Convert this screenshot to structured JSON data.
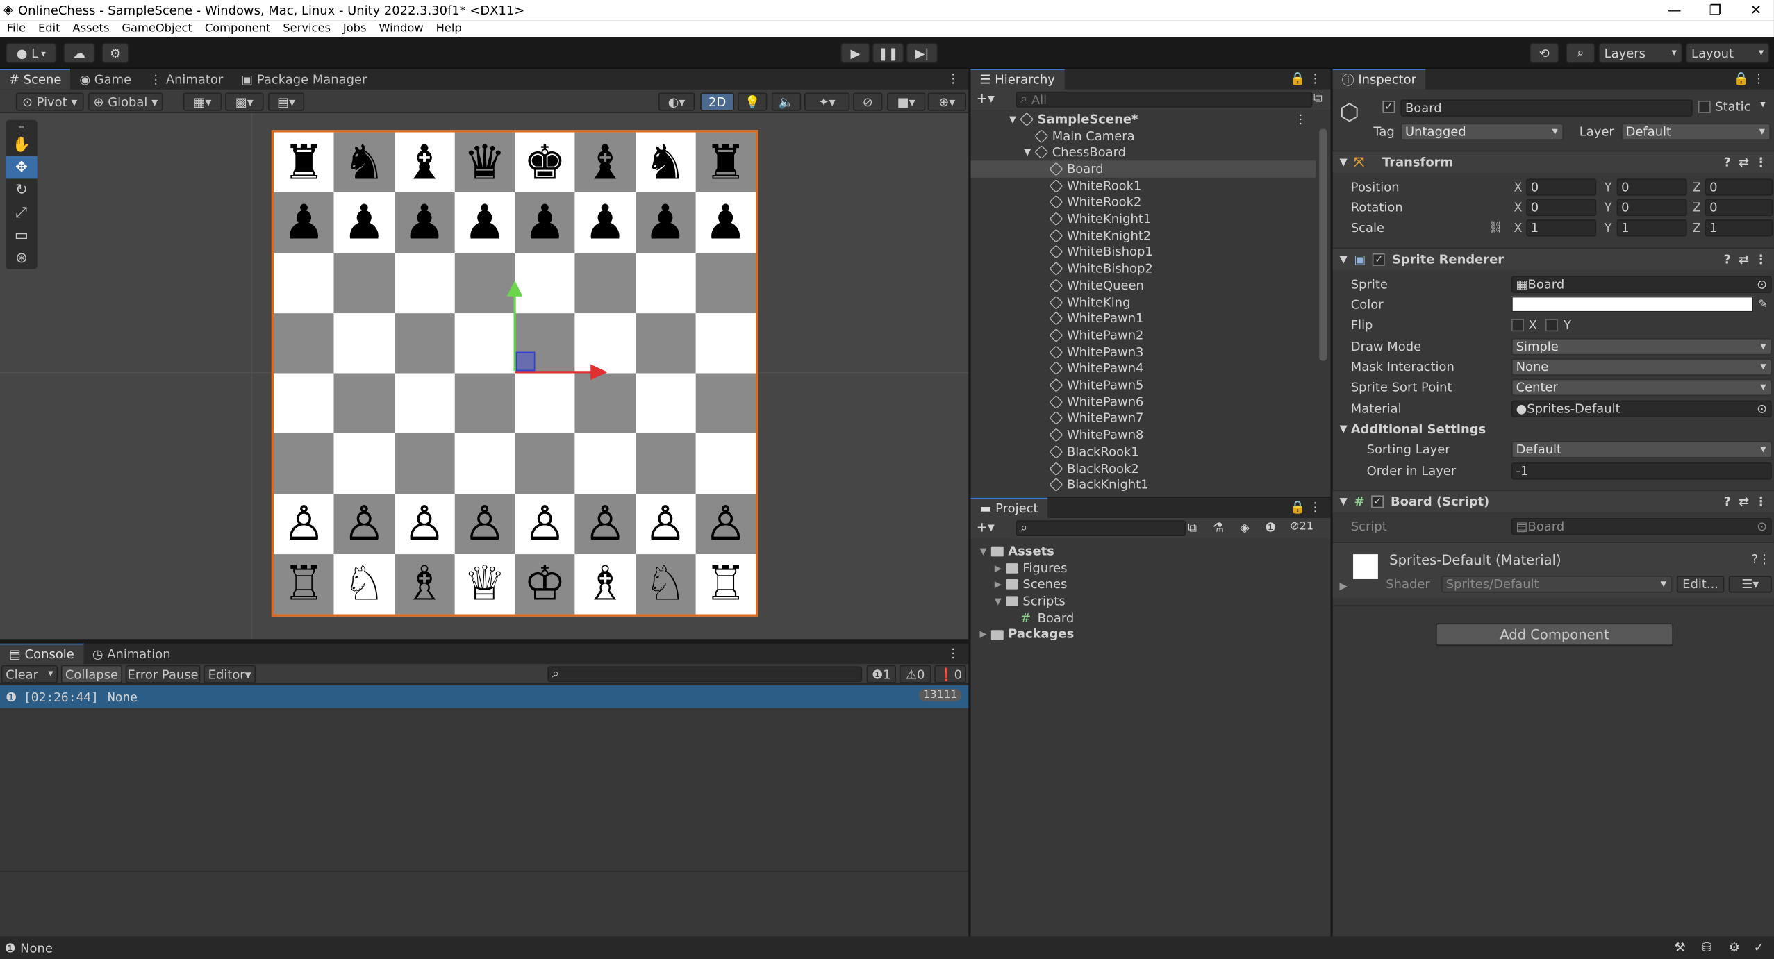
{
  "window": {
    "title": "OnlineChess - SampleScene - Windows, Mac, Linux - Unity 2022.3.30f1* <DX11>"
  },
  "menu": [
    "File",
    "Edit",
    "Assets",
    "GameObject",
    "Component",
    "Services",
    "Jobs",
    "Window",
    "Help"
  ],
  "toolbar": {
    "account_label": "L",
    "layers_label": "Layers",
    "layout_label": "Layout"
  },
  "scene_tabs": [
    "Scene",
    "Game",
    "Animator",
    "Package Manager"
  ],
  "scene_bar": {
    "pivot": "Pivot",
    "global": "Global",
    "mode_2d": "2D"
  },
  "board": {
    "rows": [
      [
        "♜",
        "♞",
        "♝",
        "♛",
        "♚",
        "♝",
        "♞",
        "♜"
      ],
      [
        "♟",
        "♟",
        "♟",
        "♟",
        "♟",
        "♟",
        "♟",
        "♟"
      ],
      [
        "",
        "",
        "",
        "",
        "",
        "",
        "",
        ""
      ],
      [
        "",
        "",
        "",
        "",
        "",
        "",
        "",
        ""
      ],
      [
        "",
        "",
        "",
        "",
        "",
        "",
        "",
        ""
      ],
      [
        "",
        "",
        "",
        "",
        "",
        "",
        "",
        ""
      ],
      [
        "♙",
        "♙",
        "♙",
        "♙",
        "♙",
        "♙",
        "♙",
        "♙"
      ],
      [
        "♖",
        "♘",
        "♗",
        "♕",
        "♔",
        "♗",
        "♘",
        "♖"
      ]
    ]
  },
  "hierarchy": {
    "title": "Hierarchy",
    "search_placeholder": "All",
    "items": [
      {
        "label": "SampleScene*",
        "depth": 0
      },
      {
        "label": "Main Camera",
        "depth": 1
      },
      {
        "label": "ChessBoard",
        "depth": 1
      },
      {
        "label": "Board",
        "depth": 2,
        "selected": true
      },
      {
        "label": "WhiteRook1",
        "depth": 2
      },
      {
        "label": "WhiteRook2",
        "depth": 2
      },
      {
        "label": "WhiteKnight1",
        "depth": 2
      },
      {
        "label": "WhiteKnight2",
        "depth": 2
      },
      {
        "label": "WhiteBishop1",
        "depth": 2
      },
      {
        "label": "WhiteBishop2",
        "depth": 2
      },
      {
        "label": "WhiteQueen",
        "depth": 2
      },
      {
        "label": "WhiteKing",
        "depth": 2
      },
      {
        "label": "WhitePawn1",
        "depth": 2
      },
      {
        "label": "WhitePawn2",
        "depth": 2
      },
      {
        "label": "WhitePawn3",
        "depth": 2
      },
      {
        "label": "WhitePawn4",
        "depth": 2
      },
      {
        "label": "WhitePawn5",
        "depth": 2
      },
      {
        "label": "WhitePawn6",
        "depth": 2
      },
      {
        "label": "WhitePawn7",
        "depth": 2
      },
      {
        "label": "WhitePawn8",
        "depth": 2
      },
      {
        "label": "BlackRook1",
        "depth": 2
      },
      {
        "label": "BlackRook2",
        "depth": 2
      },
      {
        "label": "BlackKnight1",
        "depth": 2
      }
    ]
  },
  "project": {
    "title": "Project",
    "hidden_count": "21",
    "tree": [
      {
        "label": "Assets",
        "depth": 0
      },
      {
        "label": "Figures",
        "depth": 1
      },
      {
        "label": "Scenes",
        "depth": 1
      },
      {
        "label": "Scripts",
        "depth": 1
      },
      {
        "label": "Board",
        "depth": 2
      },
      {
        "label": "Packages",
        "depth": 0
      }
    ]
  },
  "inspector": {
    "title": "Inspector",
    "object_name": "Board",
    "static_label": "Static",
    "tag_label": "Tag",
    "tag_value": "Untagged",
    "layer_label": "Layer",
    "layer_value": "Default",
    "transform": {
      "title": "Transform",
      "position_label": "Position",
      "position": [
        "0",
        "0",
        "0"
      ],
      "rotation_label": "Rotation",
      "rotation": [
        "0",
        "0",
        "0"
      ],
      "scale_label": "Scale",
      "scale": [
        "1",
        "1",
        "1"
      ]
    },
    "sprite_renderer": {
      "title": "Sprite Renderer",
      "sprite_label": "Sprite",
      "sprite": "Board",
      "color_label": "Color",
      "flip_label": "Flip",
      "flip_x": "X",
      "flip_y": "Y",
      "draw_mode_label": "Draw Mode",
      "draw_mode": "Simple",
      "mask_label": "Mask Interaction",
      "mask": "None",
      "sort_point_label": "Sprite Sort Point",
      "sort_point": "Center",
      "material_label": "Material",
      "material": "Sprites-Default",
      "additional_label": "Additional Settings",
      "sorting_layer_label": "Sorting Layer",
      "sorting_layer": "Default",
      "order_label": "Order in Layer",
      "order": "-1"
    },
    "board_script": {
      "title": "Board (Script)",
      "script_label": "Script",
      "script": "Board"
    },
    "material": {
      "title": "Sprites-Default (Material)",
      "shader_label": "Shader",
      "shader": "Sprites/Default",
      "edit_label": "Edit..."
    },
    "add_component": "Add Component"
  },
  "console": {
    "tabs": [
      "Console",
      "Animation"
    ],
    "clear": "Clear",
    "collapse": "Collapse",
    "error_pause": "Error Pause",
    "editor": "Editor",
    "counts": {
      "info": "1",
      "warn": "0",
      "error": "0"
    },
    "entry_time": "[02:26:44]",
    "entry_text": "None",
    "entry_count": "13111"
  },
  "status": {
    "text": "None"
  },
  "colors": {
    "selection": "#2c5d87",
    "board_border": "#e06a1b",
    "dark_square": "#8a8a8a"
  }
}
